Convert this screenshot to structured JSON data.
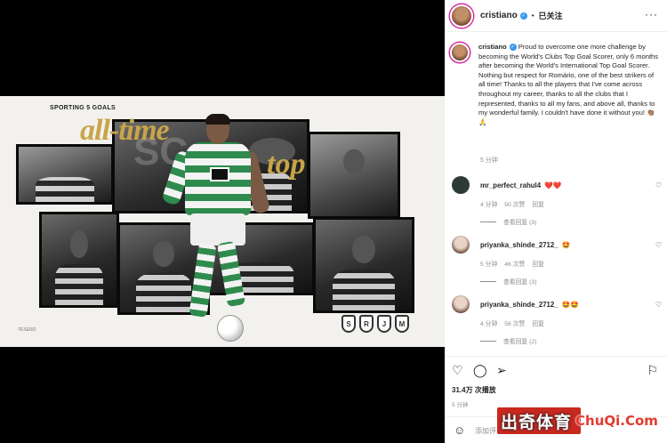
{
  "media": {
    "kicker": "SPORTING 5 GOALS",
    "title_line1": "all-time",
    "title_line2": "top",
    "signature": "TESENO",
    "crests": [
      "S",
      "R",
      "J",
      "M"
    ]
  },
  "post_header": {
    "username": "cristiano",
    "verified_icon": "verified-badge-icon",
    "follow_status": "已关注",
    "more_label": "···"
  },
  "caption": {
    "username": "cristiano",
    "text": "Proud to overcome one more challenge by becoming the World's Clubs Top Goal Scorer, only 6 months after becoming the World's International Top Goal Scorer. Nothing but respect for Romário, one of the best strikers of all time! Thanks to all the players that I've come across throughout my career, thanks to all the clubs that I represented, thanks to all my fans, and above all, thanks to my wonderful family. I couldn't have done it without you! 👏🏽🙏",
    "time": "5 分钟"
  },
  "comments": [
    {
      "username": "mr_perfect_rahul4",
      "text": "❤️❤️",
      "time": "4 分钟",
      "likes": "50 次赞",
      "reply": "回复",
      "view_replies": "查看回复 (3)"
    },
    {
      "username": "priyanka_shinde_2712_",
      "text": "🤩",
      "time": "5 分钟",
      "likes": "46 次赞",
      "reply": "回复",
      "view_replies": "查看回复 (3)"
    },
    {
      "username": "priyanka_shinde_2712_",
      "text": "🤩🤩",
      "time": "4 分钟",
      "likes": "58 次赞",
      "reply": "回复",
      "view_replies": "查看回复 (2)"
    }
  ],
  "actions": {
    "like_icon": "heart-icon",
    "comment_icon": "comment-icon",
    "share_icon": "share-icon",
    "views": "31.4万 次播放",
    "post_time": "5 分钟"
  },
  "add_comment": {
    "placeholder": "添加评"
  },
  "watermark": {
    "cn": "出奇体育",
    "en": "ChuQi.Com"
  }
}
